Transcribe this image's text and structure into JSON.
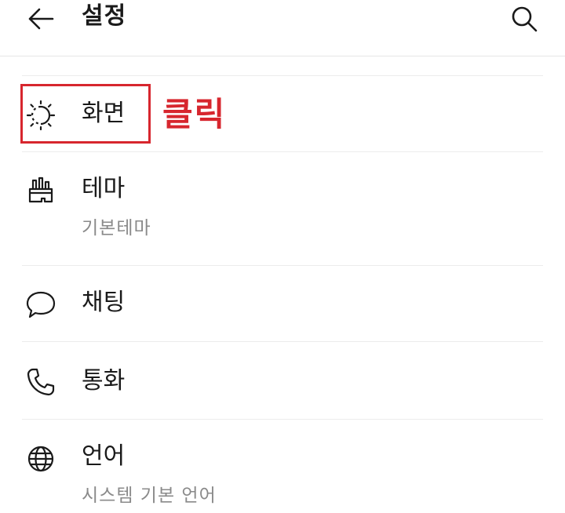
{
  "header": {
    "title": "설정",
    "back_icon": "arrow-left-icon",
    "search_icon": "search-icon"
  },
  "settings": {
    "items": [
      {
        "label": "화면",
        "sub": "",
        "icon": "brightness-icon"
      },
      {
        "label": "테마",
        "sub": "기본테마",
        "icon": "paint-brush-icon"
      },
      {
        "label": "채팅",
        "sub": "",
        "icon": "chat-bubble-icon"
      },
      {
        "label": "통화",
        "sub": "",
        "icon": "phone-icon"
      },
      {
        "label": "언어",
        "sub": "시스템 기본 언어",
        "icon": "globe-icon"
      }
    ]
  },
  "annotation": {
    "text": "클릭",
    "color": "#d7262e"
  }
}
